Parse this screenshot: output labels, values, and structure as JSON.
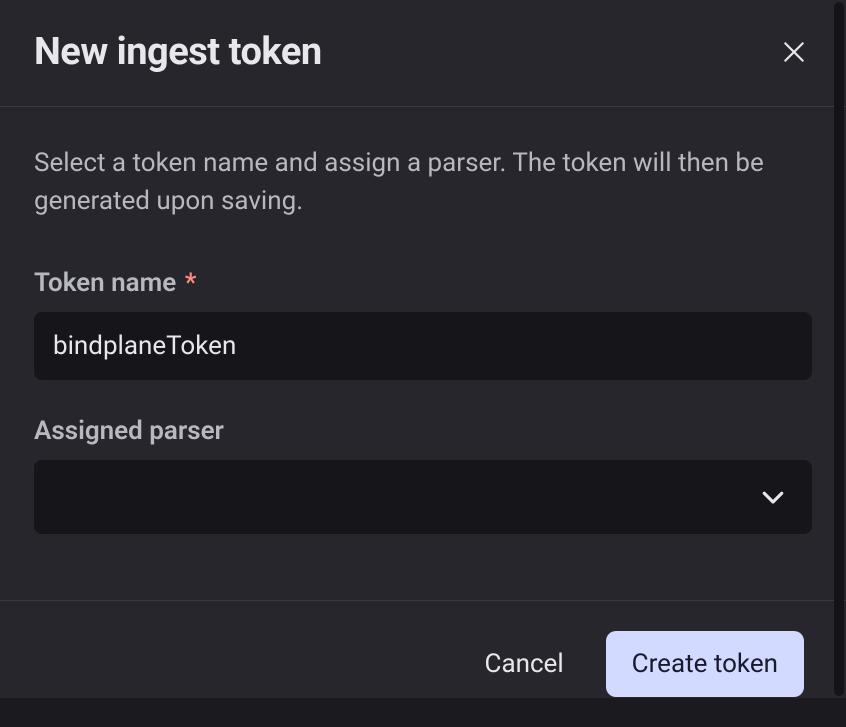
{
  "dialog": {
    "title": "New ingest token",
    "description": "Select a token name and assign a parser. The token will then be generated upon saving.",
    "fields": {
      "tokenName": {
        "label": "Token name",
        "required": true,
        "value": "bindplaneToken"
      },
      "assignedParser": {
        "label": "Assigned parser",
        "value": ""
      }
    },
    "actions": {
      "cancel": "Cancel",
      "submit": "Create token"
    }
  }
}
